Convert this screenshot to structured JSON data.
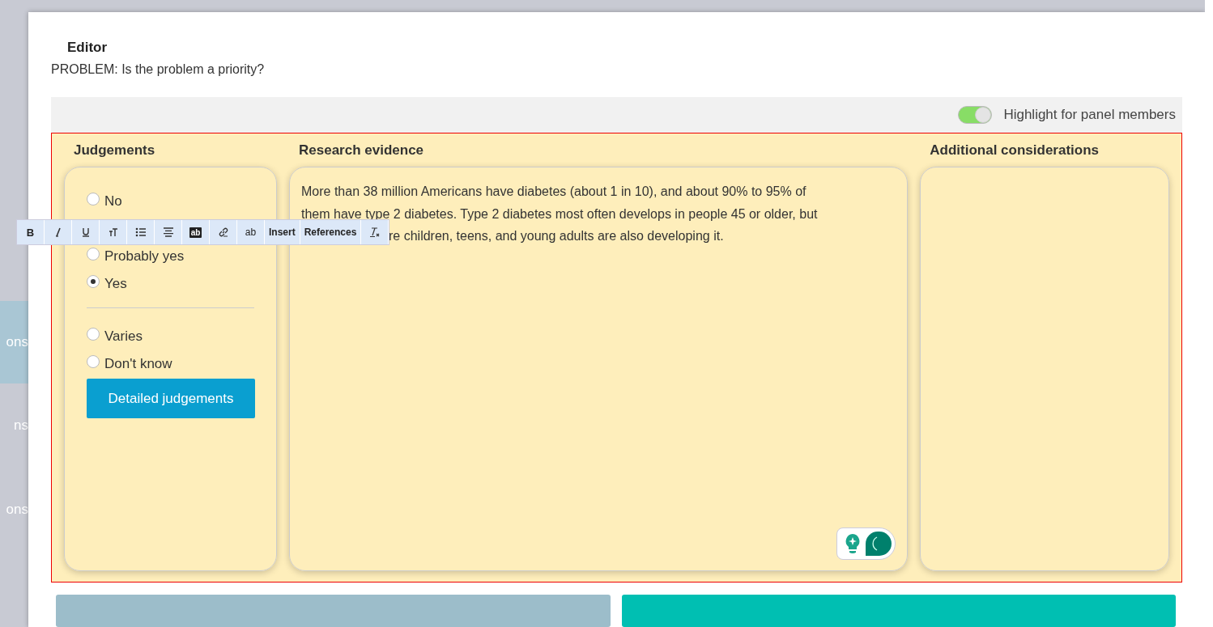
{
  "background": {
    "left_items": [
      {
        "label": "ons",
        "selected": true
      },
      {
        "label": "ns",
        "selected": false
      },
      {
        "label": "ons",
        "selected": false
      }
    ]
  },
  "modal": {
    "title": "Editor",
    "subtitle": "PROBLEM: Is the problem a priority?",
    "highlight_toggle": {
      "label": "Highlight for panel members",
      "on": true
    },
    "judgements": {
      "heading": "Judgements",
      "options": [
        {
          "label": "No",
          "selected": false
        },
        {
          "label": "Probably yes",
          "selected": false
        },
        {
          "label": "Yes",
          "selected": true
        }
      ],
      "extra_options": [
        {
          "label": "Varies",
          "selected": false
        },
        {
          "label": "Don't know",
          "selected": false
        }
      ],
      "button": "Detailed judgements"
    },
    "research": {
      "heading": "Research evidence",
      "lines": [
        "More than 38 million Americans have diabetes (about 1 in 10), and about 90% to 95% of",
        "them have type 2 diabetes. Type 2 diabetes most often develops in people 45 or older, but",
        "re children, teens, and young adults are also developing it."
      ]
    },
    "additional": {
      "heading": "Additional considerations"
    },
    "toolbar": [
      {
        "kind": "bold",
        "label": "B"
      },
      {
        "kind": "italic"
      },
      {
        "kind": "underline"
      },
      {
        "kind": "fontsize"
      },
      {
        "kind": "list"
      },
      {
        "kind": "align"
      },
      {
        "kind": "highlight",
        "label": "ab"
      },
      {
        "kind": "link"
      },
      {
        "kind": "spell",
        "label": "ab"
      },
      {
        "kind": "text",
        "label": "Insert"
      },
      {
        "kind": "text",
        "label": "References"
      },
      {
        "kind": "clear"
      }
    ]
  }
}
